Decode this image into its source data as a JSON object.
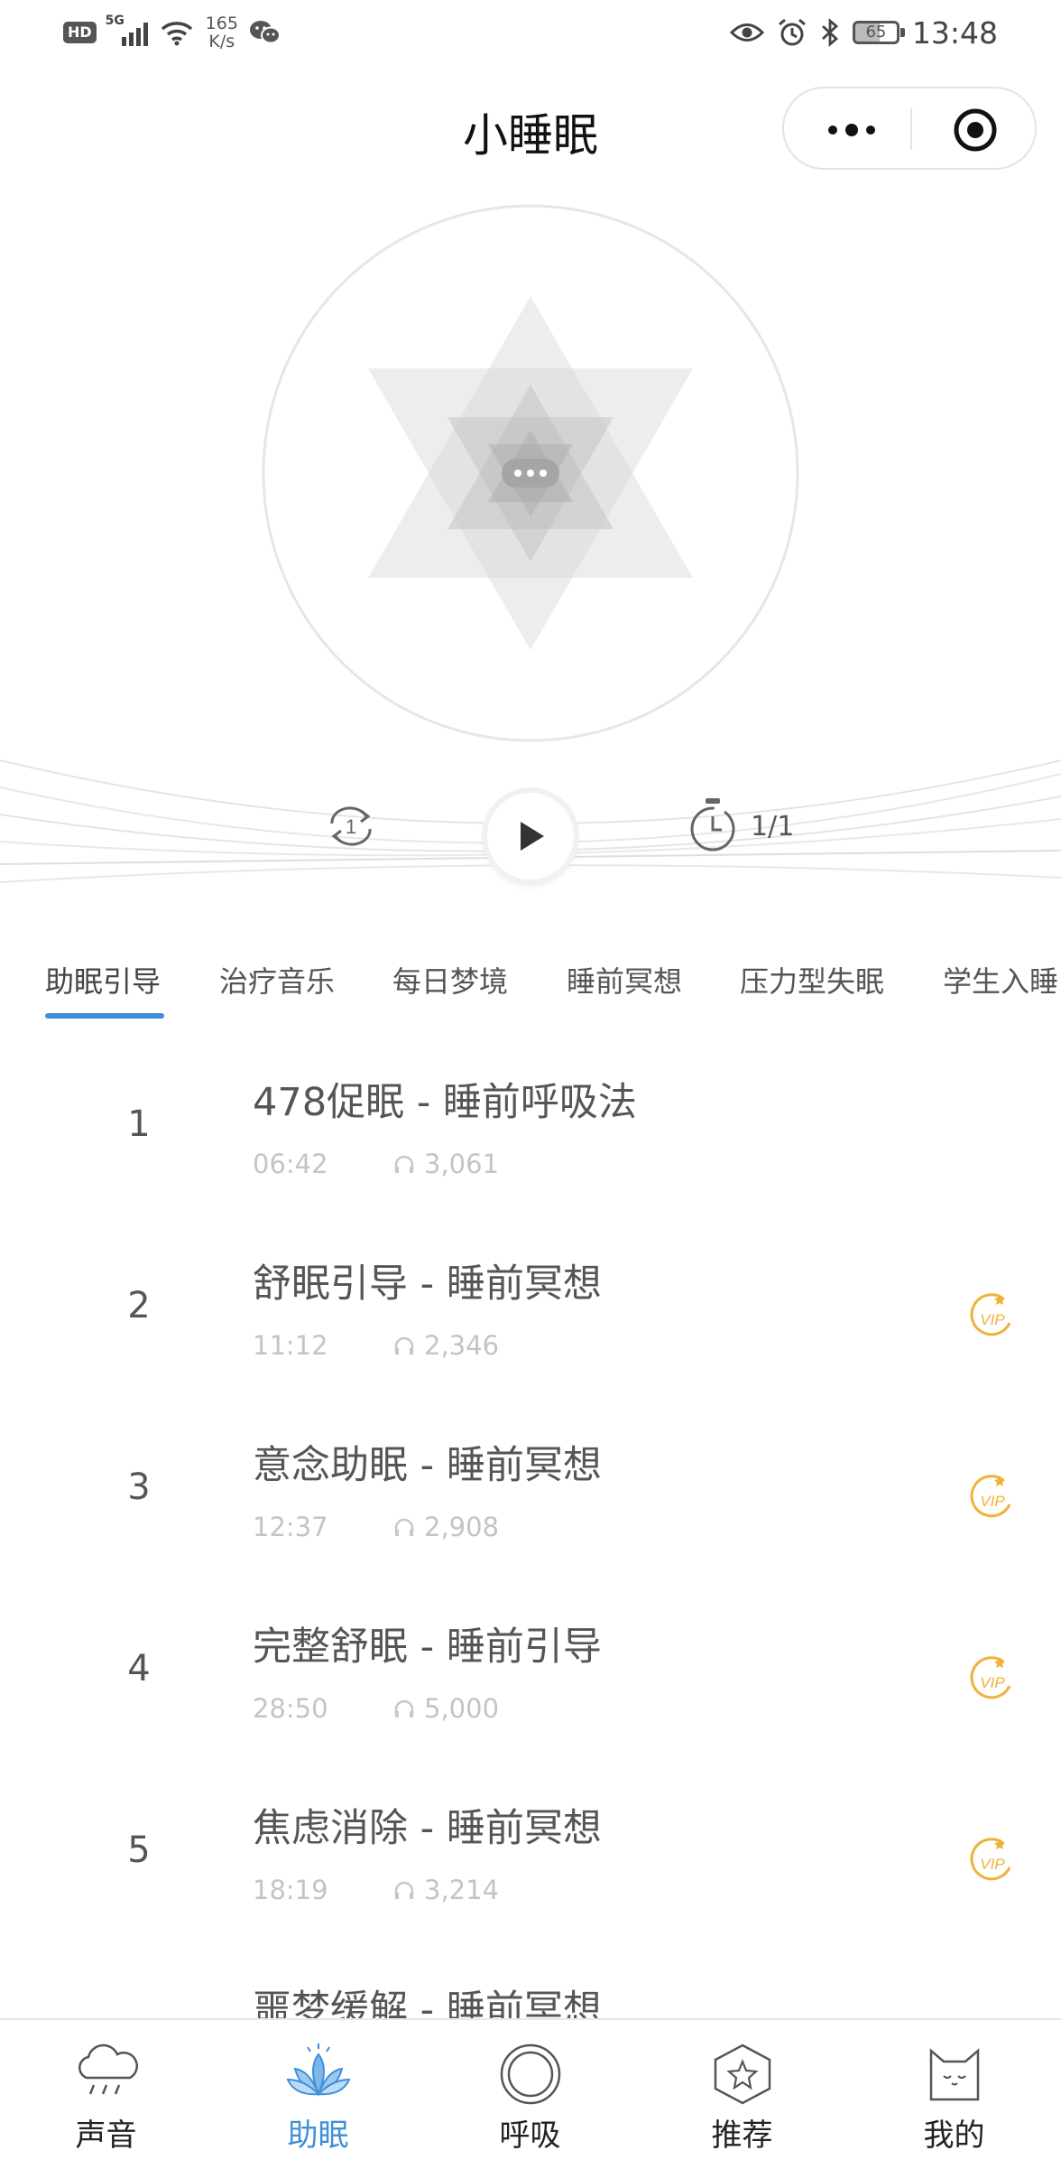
{
  "status_bar": {
    "hd": "HD",
    "network": "5G",
    "speed_value": "165",
    "speed_unit": "K/s",
    "battery": "65",
    "time": "13:48"
  },
  "header": {
    "title": "小睡眠"
  },
  "player": {
    "loop_count": "1",
    "track_counter": "1/1"
  },
  "tabs": [
    {
      "label": "助眠引导",
      "active": true
    },
    {
      "label": "治疗音乐",
      "active": false
    },
    {
      "label": "每日梦境",
      "active": false
    },
    {
      "label": "睡前冥想",
      "active": false
    },
    {
      "label": "压力型失眠",
      "active": false
    },
    {
      "label": "学生入睡",
      "active": false
    }
  ],
  "tracks": [
    {
      "num": "1",
      "title": "478促眠 - 睡前呼吸法",
      "duration": "06:42",
      "plays": "3,061",
      "vip": false
    },
    {
      "num": "2",
      "title": "舒眠引导 - 睡前冥想",
      "duration": "11:12",
      "plays": "2,346",
      "vip": true
    },
    {
      "num": "3",
      "title": "意念助眠 - 睡前冥想",
      "duration": "12:37",
      "plays": "2,908",
      "vip": true
    },
    {
      "num": "4",
      "title": "完整舒眠 - 睡前引导",
      "duration": "28:50",
      "plays": "5,000",
      "vip": true
    },
    {
      "num": "5",
      "title": "焦虑消除 - 睡前冥想",
      "duration": "18:19",
      "plays": "3,214",
      "vip": true
    },
    {
      "num": "",
      "title": "噩梦缓解 - 睡前冥想",
      "duration": "",
      "plays": "",
      "vip": true
    }
  ],
  "vip_icon_label": "VIP",
  "bottom_nav": [
    {
      "label": "声音",
      "icon": "cloud-rain-icon",
      "active": false
    },
    {
      "label": "助眠",
      "icon": "lotus-icon",
      "active": true
    },
    {
      "label": "呼吸",
      "icon": "ring-icon",
      "active": false
    },
    {
      "label": "推荐",
      "icon": "star-hexagon-icon",
      "active": false
    },
    {
      "label": "我的",
      "icon": "cat-icon",
      "active": false
    }
  ],
  "colors": {
    "accent": "#3f8fd9",
    "vip": "#f0b23a",
    "muted_text": "#c4c4c4"
  }
}
